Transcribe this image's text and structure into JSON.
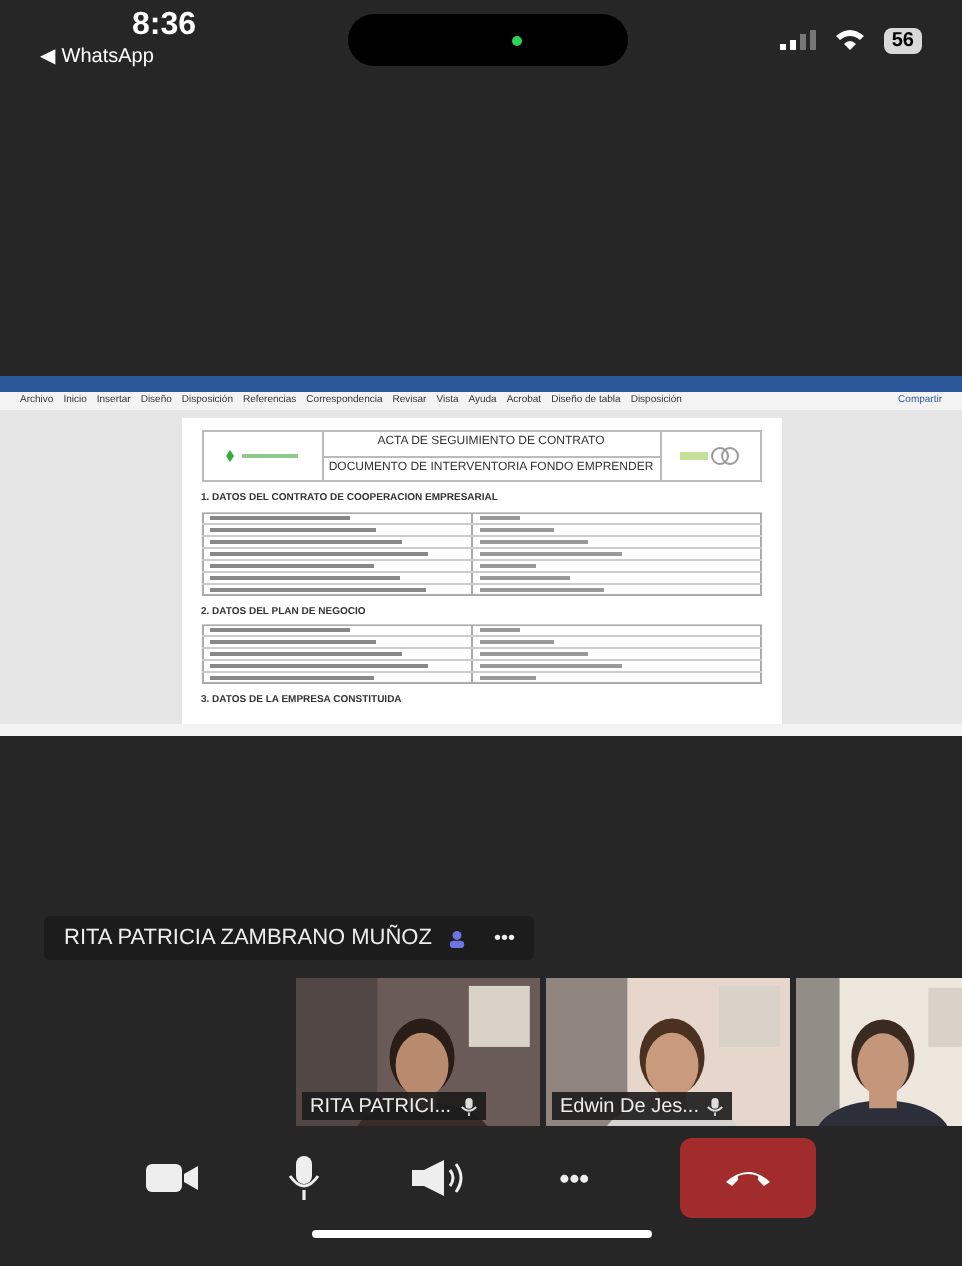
{
  "status_bar": {
    "time": "8:36",
    "back_app": "◀ WhatsApp",
    "battery": "56"
  },
  "shared_screen": {
    "ribbon_tabs": [
      "Archivo",
      "Inicio",
      "Insertar",
      "Diseño",
      "Disposición",
      "Referencias",
      "Correspondencia",
      "Revisar",
      "Vista",
      "Ayuda",
      "Acrobat",
      "Diseño de tabla",
      "Disposición"
    ],
    "share_button": "Compartir",
    "document": {
      "title": "ACTA DE SEGUIMIENTO DE CONTRATO",
      "subtitle": "DOCUMENTO DE INTERVENTORIA FONDO EMPRENDER",
      "sections": [
        {
          "heading": "1.  DATOS DEL CONTRATO DE COOPERACION EMPRESARIAL",
          "kind": "table"
        },
        {
          "heading": "2.  DATOS DEL PLAN DE NEGOCIO",
          "kind": "table"
        },
        {
          "heading": "3.  DATOS DE LA EMPRESA CONSTITUIDA",
          "kind": "heading"
        }
      ]
    }
  },
  "presenter": {
    "name": "RITA PATRICIA ZAMBRANO MUÑOZ",
    "more": "•••"
  },
  "participants": [
    {
      "name": "RITA PATRICI...",
      "kind": "picture",
      "muted": true
    },
    {
      "name": "Edwin De Jes...",
      "kind": "picture",
      "muted": true
    },
    {
      "kind": "picture"
    }
  ],
  "controls": [
    {
      "kind": "camera"
    },
    {
      "kind": "microphone"
    },
    {
      "kind": "speaker"
    },
    {
      "kind": "more",
      "label": "•••"
    },
    {
      "kind": "hangup"
    }
  ]
}
